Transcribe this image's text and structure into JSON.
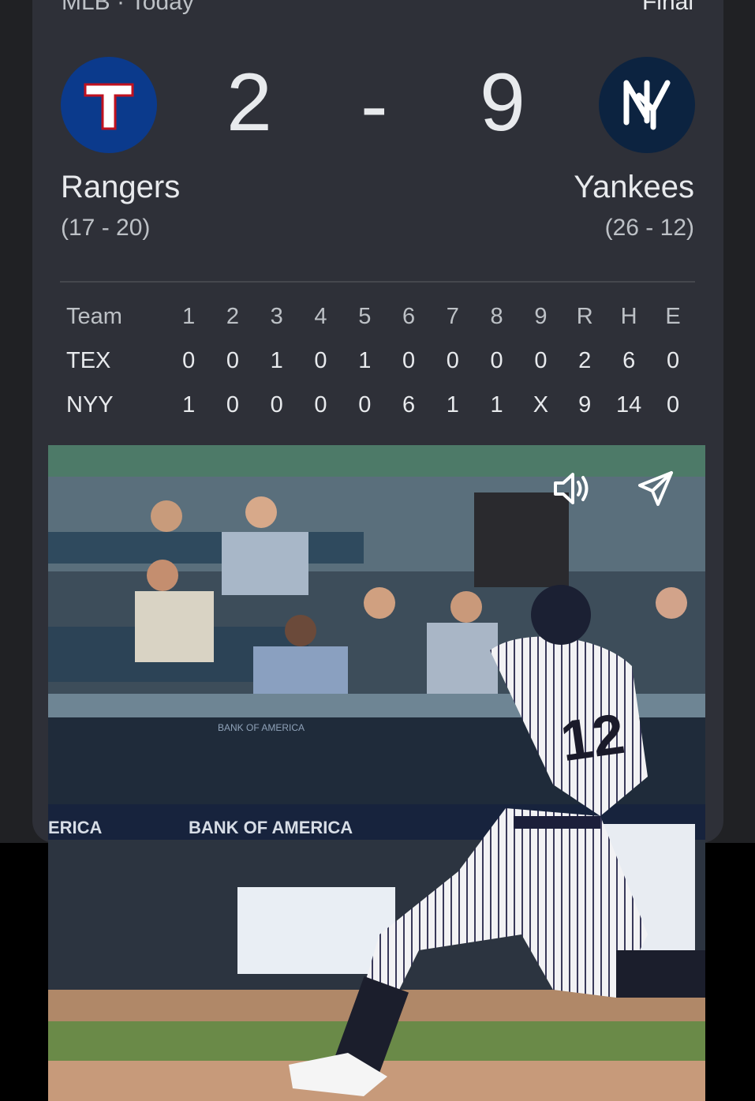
{
  "header": {
    "league_date": "MLB · Today",
    "status": "Final"
  },
  "away": {
    "abbr": "TEX",
    "name": "Rangers",
    "record": "(17 - 20)",
    "score": "2",
    "logo_letter": "T",
    "logo_color": "#0b3a8c"
  },
  "home": {
    "abbr": "NYY",
    "name": "Yankees",
    "record": "(26 - 12)",
    "score": "9",
    "logo_letter": "NY",
    "logo_color": "#0c2340"
  },
  "score_separator": "-",
  "linescore": {
    "headers": [
      "Team",
      "1",
      "2",
      "3",
      "4",
      "5",
      "6",
      "7",
      "8",
      "9",
      "R",
      "H",
      "E"
    ],
    "rows": [
      [
        "TEX",
        "0",
        "0",
        "1",
        "0",
        "1",
        "0",
        "0",
        "0",
        "0",
        "2",
        "6",
        "0"
      ],
      [
        "NYY",
        "1",
        "0",
        "0",
        "0",
        "0",
        "6",
        "1",
        "1",
        "X",
        "9",
        "14",
        "0"
      ]
    ]
  },
  "video": {
    "signage": [
      "BANK OF AMERICA",
      "BANK OF AMERICA",
      "ERICA"
    ],
    "jersey_number": "12",
    "controls": {
      "sound_icon": "speaker-icon",
      "share_icon": "send-icon"
    }
  }
}
